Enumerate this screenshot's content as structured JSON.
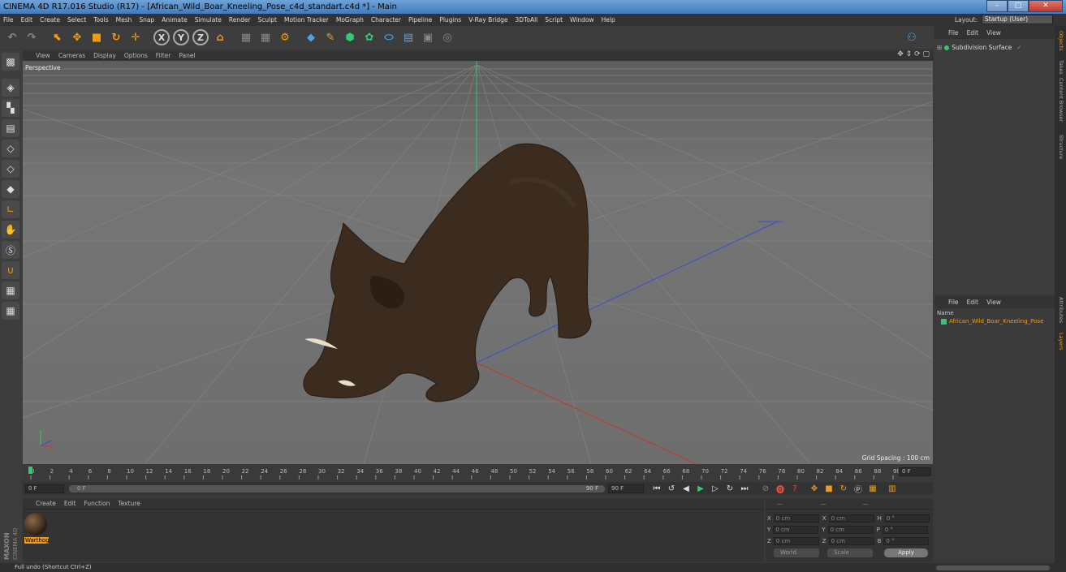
{
  "window": {
    "title": "CINEMA 4D R17.016 Studio (R17) - [African_Wild_Boar_Kneeling_Pose_c4d_standart.c4d *] - Main",
    "min": "–",
    "max": "□",
    "close": "✕"
  },
  "menu": [
    "File",
    "Edit",
    "Create",
    "Select",
    "Tools",
    "Mesh",
    "Snap",
    "Animate",
    "Simulate",
    "Render",
    "Sculpt",
    "Motion Tracker",
    "MoGraph",
    "Character",
    "Pipeline",
    "Plugins",
    "V-Ray Bridge",
    "3DToAll",
    "Script",
    "Window",
    "Help"
  ],
  "layout": {
    "label": "Layout:",
    "value": "Startup (User)"
  },
  "viewport": {
    "menu": [
      "View",
      "Cameras",
      "Display",
      "Options",
      "Filter",
      "Panel"
    ],
    "camera": "Perspective",
    "grid_spacing": "Grid Spacing : 100 cm"
  },
  "timeline": {
    "ticks": [
      "0",
      "2",
      "4",
      "6",
      "8",
      "10",
      "12",
      "14",
      "16",
      "18",
      "20",
      "22",
      "24",
      "26",
      "28",
      "30",
      "32",
      "34",
      "36",
      "38",
      "40",
      "42",
      "44",
      "46",
      "48",
      "50",
      "52",
      "54",
      "56",
      "58",
      "60",
      "62",
      "64",
      "66",
      "68",
      "70",
      "72",
      "74",
      "76",
      "78",
      "80",
      "82",
      "84",
      "86",
      "88",
      "90"
    ],
    "current_frame": "0 F"
  },
  "playback": {
    "start": "0 F",
    "slider_start": "0 F",
    "slider_end": "90 F",
    "end": "90 F"
  },
  "materials": {
    "menu": [
      "Create",
      "Edit",
      "Function",
      "Texture"
    ],
    "items": [
      {
        "name": "Warthog"
      }
    ]
  },
  "coordinates": {
    "rows": [
      {
        "a": "X",
        "av": "0 cm",
        "b": "X",
        "bv": "0 cm",
        "c": "H",
        "cv": "0 °"
      },
      {
        "a": "Y",
        "av": "0 cm",
        "b": "Y",
        "bv": "0 cm",
        "c": "P",
        "cv": "0 °"
      },
      {
        "a": "Z",
        "av": "0 cm",
        "b": "Z",
        "bv": "0 cm",
        "c": "B",
        "cv": "0 °"
      }
    ],
    "mode1": "World",
    "mode2": "Scale",
    "apply": "Apply"
  },
  "objects": {
    "menu": [
      "File",
      "Edit",
      "View"
    ],
    "items": [
      {
        "name": "Subdivision Surface"
      }
    ]
  },
  "layers": {
    "menu": [
      "File",
      "Edit",
      "View"
    ],
    "column": "Name",
    "items": [
      {
        "name": "African_Wild_Boar_Kneeling_Pose"
      }
    ]
  },
  "side_tabs": [
    "Objects",
    "Takes",
    "Content Browser",
    "Structure",
    "Attributes",
    "Layers"
  ],
  "status": "Full undo (Shortcut Ctrl+Z)",
  "maxon_logo": "MAXON CINEMA 4D",
  "colors": {
    "accent": "#f39c12",
    "object_green": "#2ecc71"
  }
}
